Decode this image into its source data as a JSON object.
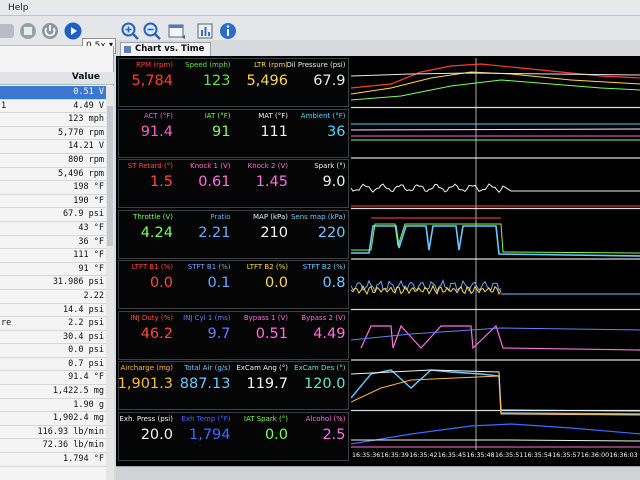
{
  "menu": {
    "help": "Help"
  },
  "toolbar": {
    "speed": "0.5x"
  },
  "left_panel": {
    "value_header": "Value",
    "rows": [
      {
        "k": "",
        "v": "0.51 V",
        "hl": true
      },
      {
        "k": "1",
        "v": "4.49 V"
      },
      {
        "k": "",
        "v": "123 mph"
      },
      {
        "k": "",
        "v": "5,770 rpm"
      },
      {
        "k": "",
        "v": "14.21 V"
      },
      {
        "k": "",
        "v": "800 rpm"
      },
      {
        "k": "",
        "v": "5,496 rpm"
      },
      {
        "k": "",
        "v": "198 °F"
      },
      {
        "k": "",
        "v": "190 °F"
      },
      {
        "k": "",
        "v": "67.9 psi"
      },
      {
        "k": "",
        "v": "43 °F"
      },
      {
        "k": "",
        "v": "36 °F"
      },
      {
        "k": "",
        "v": "111 °F"
      },
      {
        "k": "",
        "v": "91 °F"
      },
      {
        "k": "",
        "v": "31.986 psi"
      },
      {
        "k": "",
        "v": "2.22"
      },
      {
        "k": "",
        "v": "14.4 psi"
      },
      {
        "k": "re",
        "v": "2.2 psi"
      },
      {
        "k": "",
        "v": "30.4 psi"
      },
      {
        "k": "",
        "v": "0.0 psi"
      },
      {
        "k": "",
        "v": "0.7 psi"
      },
      {
        "k": "",
        "v": "91.4 °F"
      },
      {
        "k": "",
        "v": "1,422.5 mg"
      },
      {
        "k": "",
        "v": "1.90 g"
      },
      {
        "k": "",
        "v": "1,902.4 mg"
      },
      {
        "k": "",
        "v": "116.93 lb/min"
      },
      {
        "k": "",
        "v": "72.36 lb/min"
      },
      {
        "k": "",
        "v": "1.794 °F"
      }
    ]
  },
  "tab": {
    "label": "Chart vs. Time"
  },
  "groups": [
    {
      "gauges": [
        {
          "label": "RPM (rpm)",
          "value": "5,784",
          "color": "#ff3b30"
        },
        {
          "label": "Speed (mph)",
          "value": "123",
          "color": "#6fdc4a"
        },
        {
          "label": "LTR (rpm)",
          "value": "5,496",
          "color": "#ffd84a"
        },
        {
          "label": "Oil Pressure (psi)",
          "value": "67.9",
          "color": "#e8e8e8"
        }
      ]
    },
    {
      "gauges": [
        {
          "label": "ACT (°F)",
          "value": "91.4",
          "color": "#ff5fd0"
        },
        {
          "label": "IAT (°F)",
          "value": "91",
          "color": "#7cff5a"
        },
        {
          "label": "MAT (°F)",
          "value": "111",
          "color": "#f0f0f0"
        },
        {
          "label": "Ambient (°F)",
          "value": "36",
          "color": "#46d8ff"
        }
      ]
    },
    {
      "gauges": [
        {
          "label": "ST Retard (°)",
          "value": "1.5",
          "color": "#ff4a3a"
        },
        {
          "label": "Knock 1 (V)",
          "value": "0.61",
          "color": "#ff6fe0"
        },
        {
          "label": "Knock 2 (V)",
          "value": "1.45",
          "color": "#ff6fe0"
        },
        {
          "label": "Spark (°)",
          "value": "9.0",
          "color": "#f2f2f2"
        }
      ]
    },
    {
      "gauges": [
        {
          "label": "Throttle (V)",
          "value": "4.24",
          "color": "#7cff5a"
        },
        {
          "label": "Pratio",
          "value": "2.21",
          "color": "#6aa8ff"
        },
        {
          "label": "MAP (kPa)",
          "value": "210",
          "color": "#f2f2f2"
        },
        {
          "label": "Sens map (kPa)",
          "value": "220",
          "color": "#6ac8ff"
        }
      ]
    },
    {
      "gauges": [
        {
          "label": "LTFT B1 (%)",
          "value": "0.0",
          "color": "#ff4a3a"
        },
        {
          "label": "STFT B1 (%)",
          "value": "0.1",
          "color": "#6aa8ff"
        },
        {
          "label": "LTFT B2 (%)",
          "value": "0.0",
          "color": "#ffd84a"
        },
        {
          "label": "STFT B2 (%)",
          "value": "0.8",
          "color": "#6ac8ff"
        }
      ]
    },
    {
      "gauges": [
        {
          "label": "INJ Duty (%)",
          "value": "46.2",
          "color": "#ff4a3a"
        },
        {
          "label": "INJ Cyl 1 (ms)",
          "value": "9.7",
          "color": "#6a7cff"
        },
        {
          "label": "Bypass 1 (V)",
          "value": "0.51",
          "color": "#ff6fe0"
        },
        {
          "label": "Bypass 2 (V)",
          "value": "4.49",
          "color": "#ff6fe0"
        }
      ]
    },
    {
      "gauges": [
        {
          "label": "Aircharge (mg)",
          "value": "1,901.3",
          "color": "#ffbb3a"
        },
        {
          "label": "Total Air (g/s)",
          "value": "887.13",
          "color": "#6ac8ff"
        },
        {
          "label": "ExCam Ang (°)",
          "value": "119.7",
          "color": "#f2f2f2"
        },
        {
          "label": "ExCam Des (°)",
          "value": "120.0",
          "color": "#5ce8d0"
        }
      ]
    },
    {
      "gauges": [
        {
          "label": "Exh. Press (psi)",
          "value": "20.0",
          "color": "#f2f2f2"
        },
        {
          "label": "Exh Temp (°F)",
          "value": "1,794",
          "color": "#3a6cff"
        },
        {
          "label": "IAT Spark (°)",
          "value": "0.0",
          "color": "#7cff5a"
        },
        {
          "label": "Alcohol (%)",
          "value": "2.5",
          "color": "#ff6fe0"
        }
      ]
    }
  ],
  "time_axis": [
    "16:35:36",
    "16:35:39",
    "16:35:42",
    "16:35:45",
    "16:35:48",
    "16:35:51",
    "16:35:54",
    "16:35:57",
    "16:36:00",
    "16:36:03"
  ]
}
